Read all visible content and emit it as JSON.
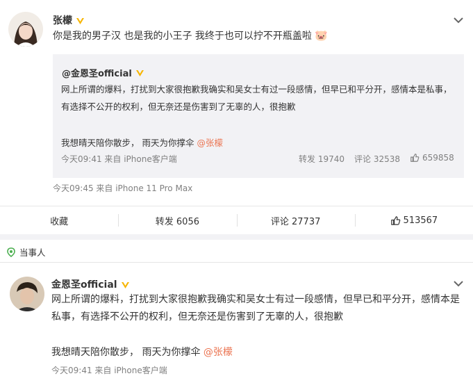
{
  "post1": {
    "author": "张檬",
    "text": "你是我的男子汉 也是我的小王子 我终于也可以拧不开瓶盖啦",
    "emoji": "🐷",
    "meta": "今天09:45 来自 iPhone 11 Pro Max",
    "repost": {
      "author": "@金恩圣official",
      "text1": "网上所谓的爆料，打扰到大家很抱歉我确实和吴女士有过一段感情，但早已和平分开，感情本是私事，有选择不公开的权利，但无奈还是伤害到了无辜的人，很抱歉",
      "text2_prefix": "我想晴天陪你散步， 雨天为你撑伞 ",
      "text2_mention": "@张檬",
      "meta": "今天09:41 来自 iPhone客户端",
      "repost_label": "转发 19740",
      "comment_label": "评论 32538",
      "like_count": "659858"
    }
  },
  "actions": {
    "favorite": "收藏",
    "repost": "转发 6056",
    "comment": "评论 27737",
    "like": "513567"
  },
  "tag": {
    "label": "当事人"
  },
  "post2": {
    "author": "金恩圣official",
    "text1": "网上所谓的爆料，打扰到大家很抱歉我确实和吴女士有过一段感情，但早已和平分开，感情本是私事，有选择不公开的权利，但无奈还是伤害到了无辜的人，很抱歉",
    "text2_prefix": "我想晴天陪你散步， 雨天为你撑伞 ",
    "text2_mention": "@张檬",
    "meta": "今天09:41 来自 iPhone客户端"
  },
  "colors": {
    "link": "#eb7350",
    "verified": "#f7b500",
    "meta": "#808080"
  }
}
